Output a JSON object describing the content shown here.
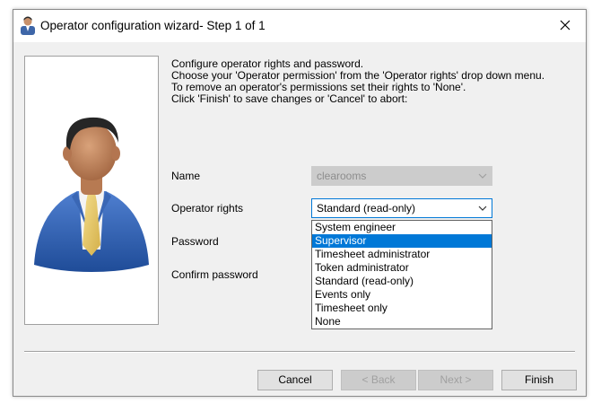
{
  "window": {
    "title": "Operator configuration wizard- Step 1 of 1"
  },
  "instructions": {
    "lines": [
      "Configure operator rights and password.",
      "Choose your 'Operator permission' from the 'Operator rights' drop down menu.",
      "To remove an operator's permissions set their rights to 'None'.",
      "Click 'Finish' to save changes or 'Cancel' to abort:"
    ]
  },
  "form": {
    "name_label": "Name",
    "name_value": "clearooms",
    "rights_label": "Operator rights",
    "rights_value": "Standard (read-only)",
    "password_label": "Password",
    "confirm_label": "Confirm password"
  },
  "dropdown": {
    "options": [
      "System engineer",
      "Supervisor",
      "Timesheet administrator",
      "Token administrator",
      "Standard (read-only)",
      "Events only",
      "Timesheet only",
      "None"
    ],
    "highlighted": "Supervisor"
  },
  "buttons": {
    "cancel": "Cancel",
    "back": "< Back",
    "next": "Next >",
    "finish": "Finish"
  },
  "colors": {
    "highlight": "#0078d7",
    "dialog_bg": "#f0f0f0"
  }
}
